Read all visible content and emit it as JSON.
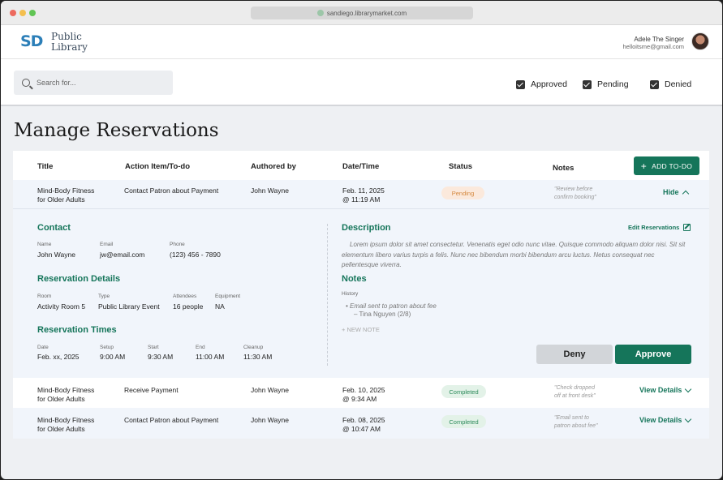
{
  "browser": {
    "url": "sandiego.librarymarket.com"
  },
  "header": {
    "logo_mark": "SD",
    "logo_line1": "Public",
    "logo_line2": "Library",
    "user_name": "Adele The Singer",
    "user_email": "helloitsme@gmail.com"
  },
  "filters": {
    "search_placeholder": "Search for...",
    "approved": "Approved",
    "pending": "Pending",
    "denied": "Denied"
  },
  "page": {
    "title": "Manage Reservations"
  },
  "table": {
    "columns": [
      "Title",
      "Action Item/To-do",
      "Authored by",
      "Date/Time",
      "Status",
      "Notes"
    ],
    "add_button": "ADD TO-DO",
    "rows": [
      {
        "title1": "Mind-Body Fitness",
        "title2": "for Older Adults",
        "action": "Contact Patron about Payment",
        "author": "John Wayne",
        "date1": "Feb. 11, 2025",
        "date2": "@ 11:19 AM",
        "status": "Pending",
        "note1": "\"Review before",
        "note2": "confirm booking\"",
        "action_link": "Hide"
      },
      {
        "title1": "Mind-Body Fitness",
        "title2": "for Older Adults",
        "action": "Receive Payment",
        "author": "John Wayne",
        "date1": "Feb. 10, 2025",
        "date2": "@ 9:34 AM",
        "status": "Completed",
        "note1": "\"Check dropped",
        "note2": "off at front desk\"",
        "action_link": "View Details"
      },
      {
        "title1": "Mind-Body Fitness",
        "title2": "for Older Adults",
        "action": "Contact Patron about Payment",
        "author": "John Wayne",
        "date1": "Feb. 08, 2025",
        "date2": "@ 10:47 AM",
        "status": "Completed",
        "note1": "\"Email sent to",
        "note2": "patron about fee\"",
        "action_link": "View Details"
      }
    ]
  },
  "details": {
    "contact": {
      "title": "Contact",
      "name_label": "Name",
      "name": "John Wayne",
      "email_label": "Email",
      "email": "jw@email.com",
      "phone_label": "Phone",
      "phone": "(123) 456 - 7890"
    },
    "reservation": {
      "title": "Reservation Details",
      "room_label": "Room",
      "room": "Activity Room 5",
      "type_label": "Type",
      "type": "Public Library Event",
      "attendees_label": "Attendees",
      "attendees": "16 people",
      "equipment_label": "Equipment",
      "equipment": "NA"
    },
    "times": {
      "title": "Reservation Times",
      "date_label": "Date",
      "date": "Feb. xx, 2025",
      "setup_label": "Setup",
      "setup": "9:00 AM",
      "start_label": "Start",
      "start": "9:30 AM",
      "end_label": "End",
      "end": "11:00 AM",
      "cleanup_label": "Cleanup",
      "cleanup": "11:30 AM"
    },
    "description": {
      "title": "Description",
      "edit_link": "Edit Reservations",
      "text": "Lorem ipsum dolor sit amet consectetur. Venenatis eget odio nunc vitae. Quisque commodo aliquam dolor nisi. Sit sit elementum libero varius turpis a felis. Nunc nec bibendum morbi bibendum arcu luctus. Netus consequat nec pellentesque viverra."
    },
    "notes": {
      "title": "Notes",
      "history_label": "History",
      "history_item": "Email sent to patron about fee",
      "history_author": "– Tina Nguyen (2/8)",
      "new_note": "+ NEW NOTE"
    },
    "deny_button": "Deny",
    "approve_button": "Approve"
  }
}
